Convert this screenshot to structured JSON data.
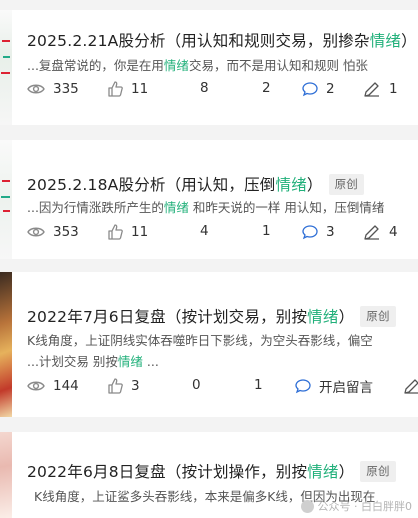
{
  "posts": [
    {
      "title_pre": "2025.2.21A股分析（用认知和规则交易，别掺杂",
      "title_hl": "情绪",
      "title_post": "）",
      "badge": "",
      "desc_lines": [
        {
          "pre": "...复盘常说的，你是在用",
          "hl": "情绪",
          "post": "交易，而不是用认知和规则 怕张"
        }
      ],
      "views": "335",
      "likes": "11",
      "shares": "8",
      "favorites": "2",
      "comments": "2",
      "edits": "1"
    },
    {
      "title_pre": "2025.2.18A股分析（用认知，压倒",
      "title_hl": "情绪",
      "title_post": "）",
      "badge": "原创",
      "desc_lines": [
        {
          "pre": "...因为行情涨跌所产生的",
          "hl": "情绪",
          "post": " 和昨天说的一样 用认知，压倒情绪"
        }
      ],
      "views": "353",
      "likes": "11",
      "shares": "4",
      "favorites": "1",
      "comments": "3",
      "edits": "4"
    },
    {
      "title_pre": "2022年7月6日复盘（按计划交易，别按",
      "title_hl": "情绪",
      "title_post": "）",
      "badge": "原创",
      "desc_lines": [
        {
          "pre": "K线角度，上证阴线实体吞噬昨日下影线，为空头吞影线，偏空",
          "hl": "",
          "post": ""
        },
        {
          "pre": "...计划交易 别按",
          "hl": "情绪",
          "post": " ..."
        }
      ],
      "views": "144",
      "likes": "3",
      "shares": "0",
      "favorites": "1",
      "comments": "开启留言",
      "edits": ""
    },
    {
      "title_pre": "2022年6月8日复盘（按计划操作，别按",
      "title_hl": "情绪",
      "title_post": "）",
      "badge": "原创",
      "desc_lines": [
        {
          "pre": "K线角度，上证鲨多头吞影线，本来是偏多K线，但因为出现在",
          "hl": "",
          "post": ""
        }
      ]
    }
  ],
  "watermark": "公众号 · 白白胖胖0"
}
